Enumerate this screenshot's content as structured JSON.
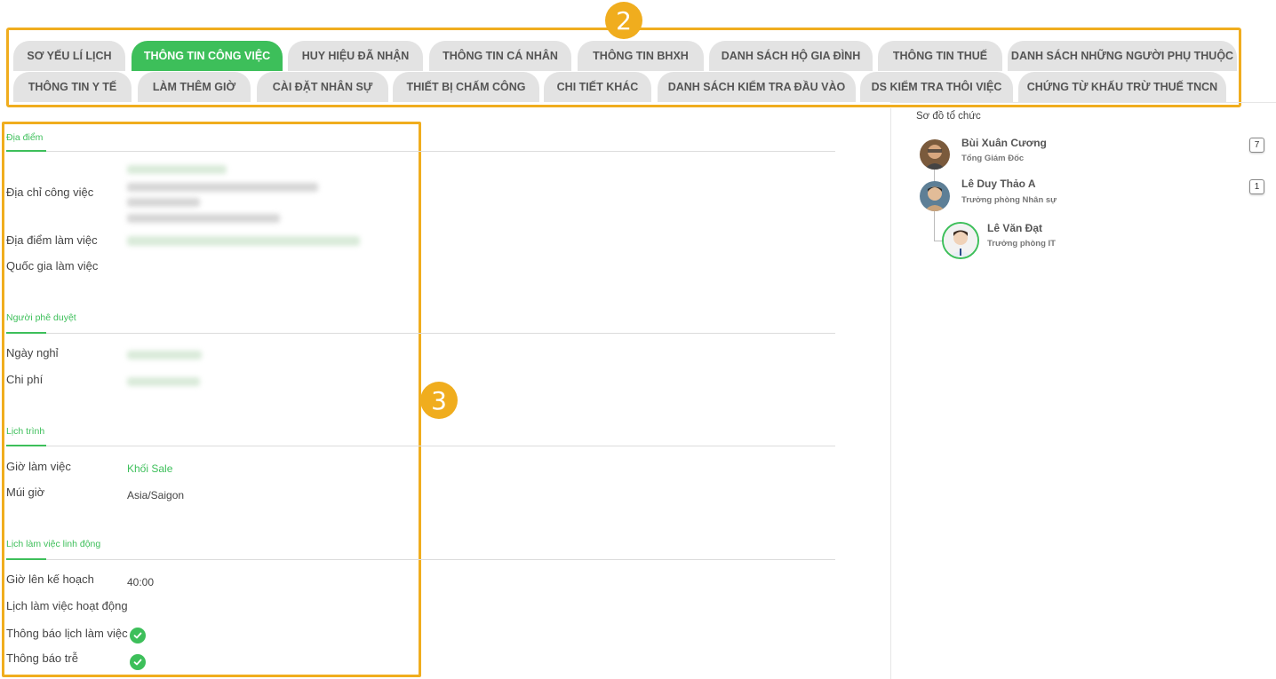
{
  "annotations": {
    "badge_2": "2",
    "badge_3": "3"
  },
  "tabs": [
    "SƠ YẾU LÍ LỊCH",
    "THÔNG TIN CÔNG VIỆC",
    "HUY HIỆU ĐÃ NHẬN",
    "THÔNG TIN CÁ NHÂN",
    "THÔNG TIN BHXH",
    "DANH SÁCH HỘ GIA ĐÌNH",
    "THÔNG TIN THUẾ",
    "DANH SÁCH NHỮNG NGƯỜI PHỤ THUỘC",
    "THÔNG TIN Y TẾ",
    "LÀM THÊM GIỜ",
    "CÀI ĐẶT NHÂN SỰ",
    "THIẾT BỊ CHẤM CÔNG",
    "CHI TIẾT KHÁC",
    "DANH SÁCH KIỂM TRA ĐẦU VÀO",
    "DS KIỂM TRA THÔI VIỆC",
    "CHỨNG TỪ KHẤU TRỪ THUẾ TNCN"
  ],
  "active_tab": "THÔNG TIN CÔNG VIỆC",
  "sections": {
    "location": {
      "title": "Địa điểm",
      "work_address_label": "Địa chỉ công việc",
      "work_place_label": "Địa điểm làm việc",
      "work_country_label": "Quốc gia làm việc"
    },
    "approver": {
      "title": "Người phê duyệt",
      "leave_label": "Ngày nghỉ",
      "expense_label": "Chi phí"
    },
    "schedule": {
      "title": "Lịch trình",
      "working_hours_label": "Giờ làm việc",
      "working_hours_value": "Khối Sale",
      "timezone_label": "Múi giờ",
      "timezone_value": "Asia/Saigon"
    },
    "flexible": {
      "title": "Lịch làm việc linh động",
      "planned_hours_label": "Giờ lên kế hoạch",
      "planned_hours_value": "40:00",
      "active_schedule_label": "Lịch làm việc hoạt động",
      "schedule_notify_label": "Thông báo lịch làm việc",
      "schedule_notify_checked": true,
      "late_notify_label": "Thông báo trễ",
      "late_notify_checked": true
    }
  },
  "org_chart": {
    "title": "Sơ đồ tổ chức",
    "people": [
      {
        "name": "Bùi Xuân Cương",
        "role": "Tổng Giám Đốc",
        "count": "7"
      },
      {
        "name": "Lê Duy Thảo A",
        "role": "Trưởng phòng Nhân sự",
        "count": "1"
      },
      {
        "name": "Lê Văn Đạt",
        "role": "Trưởng phòng IT"
      }
    ]
  },
  "colors": {
    "accent": "#3dbf5a",
    "highlight": "#f0ad1e",
    "tab_bg": "#e3e3e3"
  }
}
